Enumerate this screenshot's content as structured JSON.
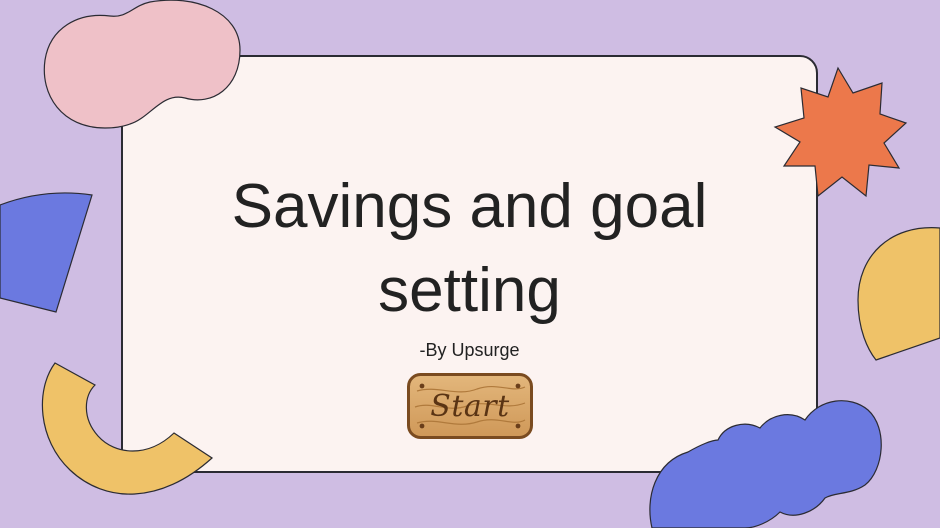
{
  "slide": {
    "title_line1": "Savings and goal",
    "title_line2": "setting",
    "subtitle": "-By Upsurge"
  },
  "start_button": {
    "label": "Start"
  },
  "colors": {
    "background": "#cfbde3",
    "card": "#fcf3f1",
    "pink": "#efc1c8",
    "orange": "#ec784b",
    "blue": "#6b79e0",
    "yellow": "#efc268",
    "wood": "#d9a466"
  },
  "decorations": [
    "pink-blob",
    "orange-star",
    "blue-quarter-circle",
    "yellow-half-disc",
    "yellow-ring",
    "blue-cloud"
  ]
}
